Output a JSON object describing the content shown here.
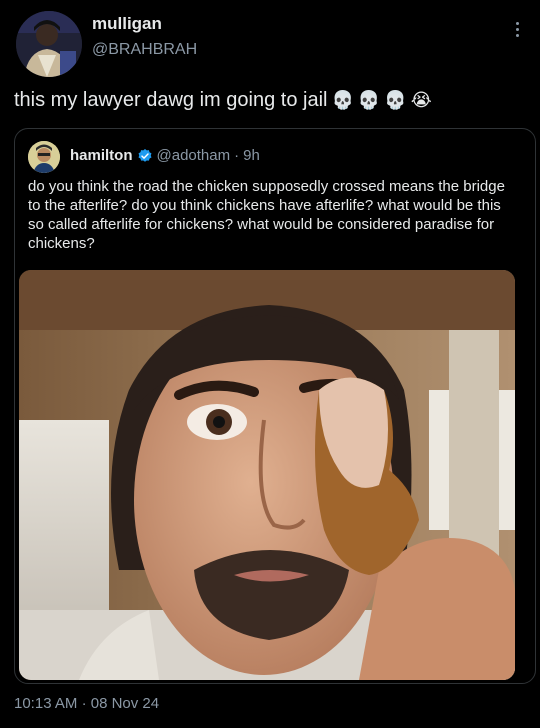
{
  "author": {
    "name": "mulligan",
    "handle": "@BRAHBRAH",
    "avatar_icon": "profile-photo-icon"
  },
  "tweet": {
    "text": "this my lawyer dawg im going to jail",
    "emojis": [
      "💀",
      "💀",
      "💀",
      "😭"
    ]
  },
  "quoted": {
    "name": "hamilton",
    "handle": "@adotham",
    "separator": "·",
    "age": "9h",
    "verified_color": "#1d9bf0",
    "text": "do you think the road the chicken supposedly crossed means the bridge to the afterlife? do you think chickens have afterlife? what would be this so called afterlife for chickens? what would be considered paradise for chickens?",
    "image_icon": "man-holding-chicken-nugget-photo"
  },
  "footer": {
    "time": "10:13 AM",
    "separator": "·",
    "date": "08 Nov 24"
  },
  "colors": {
    "background": "#000000",
    "text": "#e7e9ea",
    "muted": "#8b98a5",
    "border": "#2f3336"
  }
}
